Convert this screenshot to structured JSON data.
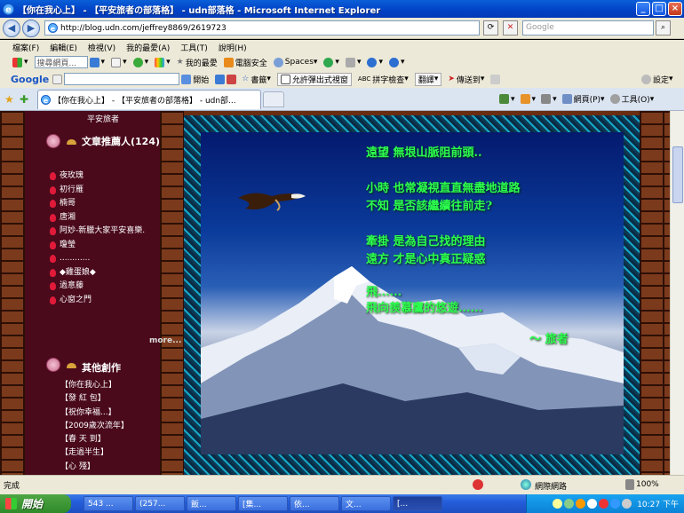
{
  "window": {
    "title": "【你在我心上】 - 【平安旅者の部落格】 - udn部落格 - Microsoft Internet Explorer"
  },
  "address_bar": {
    "url": "http://blog.udn.com/jeffrey8869/2619723",
    "search_placeholder": "Google"
  },
  "menu": [
    "檔案(F)",
    "編輯(E)",
    "檢視(V)",
    "我的最愛(A)",
    "工具(T)",
    "說明(H)"
  ],
  "toolbar1": {
    "search_placeholder": "搜尋網頁...",
    "open_label": "開始",
    "favorites_label": "我的最愛",
    "security_label": "電腦安全",
    "spaces_label": "Spaces"
  },
  "toolbar2": {
    "google_label": "Google",
    "bookmarks_label": "書籤",
    "popup_label": "允許彈出式視窗",
    "spellcheck_label": "拼字檢查",
    "translate_label": "翻譯",
    "send_label": "傳送到",
    "settings_label": "設定"
  },
  "tabs": {
    "active_label": "【你在我心上】 - 【平安旅者の部落格】 - udn部...",
    "page_label": "網頁(P)",
    "tools_label": "工具(O)"
  },
  "sidebar": {
    "top_label": "平安旅者",
    "recommenders_title": "文章推薦人(124)",
    "recommenders": [
      "夜玫瑰",
      "初行雁",
      "楠哥",
      "唐湘",
      "阿妙-新臘大家平安喜樂.",
      "瓊瑩",
      "............",
      "◆雞蛋娘◆",
      "過意藤",
      "心窗之門"
    ],
    "more_label": "more...",
    "others_title": "其他創作",
    "others": [
      "【你在我心上】",
      "【發 紅 包】",
      "【祝你幸福...】",
      "【2009歲次流年】",
      "【春 天 到】",
      "【走過半生】",
      "【心 殘】"
    ]
  },
  "poem": {
    "lines": [
      "遠望  無垠山脈阻前頭..",
      "小時  也常凝視直直無盡地道路",
      "不知  是否該繼續往前走?",
      "牽掛  是為自己找的理由",
      "遠方  才是心中真正疑惑",
      "飛......",
      "飛向羨慕鷹的悠遊......",
      "～ 旅者"
    ]
  },
  "status": {
    "text": "完成",
    "zone_label": "網際網路",
    "zoom_label": "100%"
  },
  "taskbar": {
    "start_label": "開始",
    "tasks": [
      "543 ...",
      "(257...",
      "飯...",
      "[集...",
      "依...",
      "文...",
      "[..."
    ],
    "clock": "10:27 下午"
  },
  "colors": {
    "sidebar_bg": "#4a0a1c",
    "poem_green": "#2cff4e",
    "title_blue": "#0246c9"
  }
}
